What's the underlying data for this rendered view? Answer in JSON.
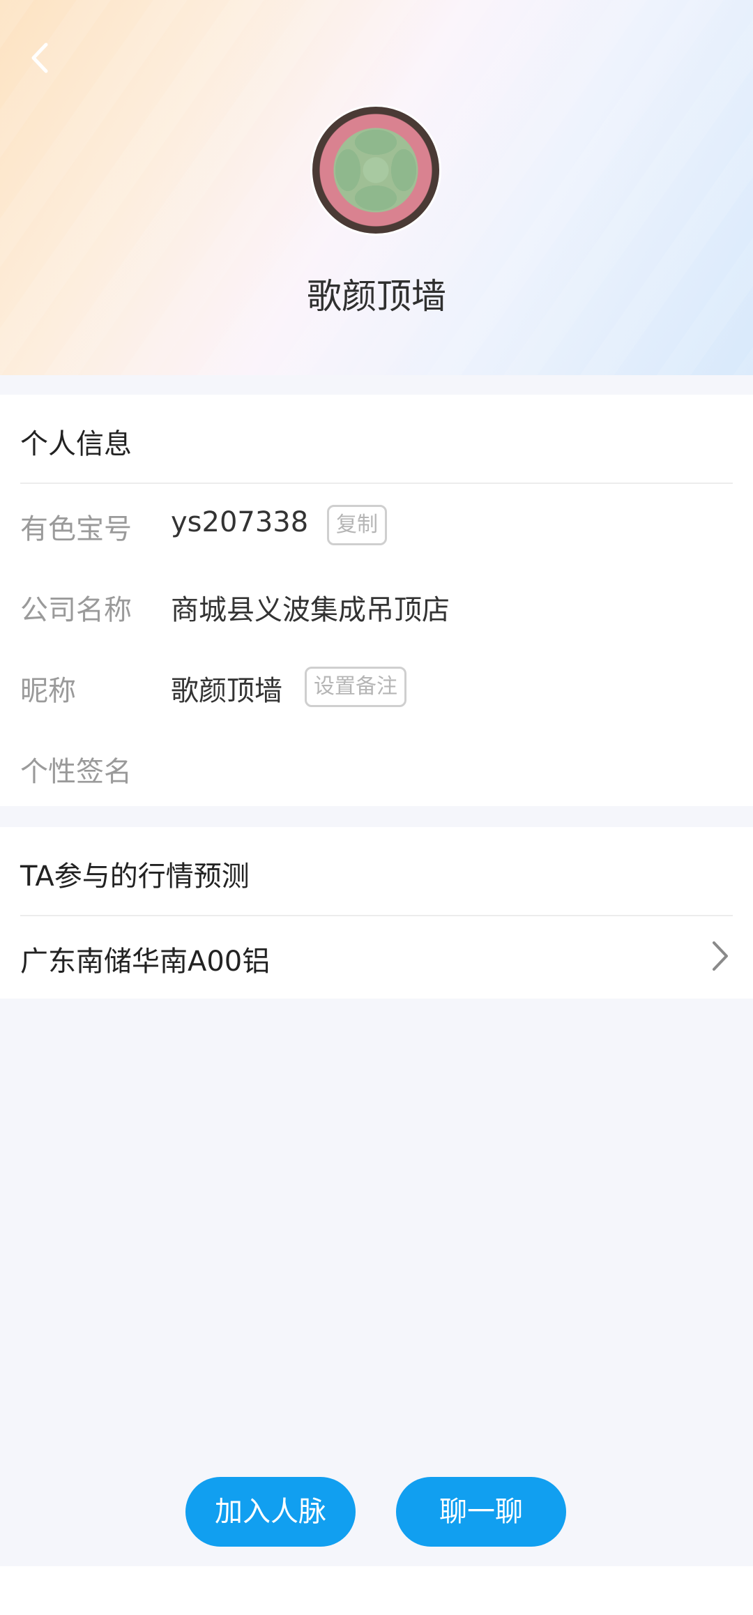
{
  "profile": {
    "name": "歌颜顶墙"
  },
  "personal_info": {
    "title": "个人信息",
    "rows": [
      {
        "label": "有色宝号",
        "value": "ys207338",
        "action": "复制"
      },
      {
        "label": "公司名称",
        "value": "商城县义波集成吊顶店"
      },
      {
        "label": "昵称",
        "value": "歌颜顶墙",
        "action": "设置备注"
      },
      {
        "label": "个性签名",
        "value": ""
      }
    ]
  },
  "predictions": {
    "title": "TA参与的行情预测",
    "items": [
      {
        "label": "广东南储华南A00铝"
      }
    ]
  },
  "buttons": {
    "add_contact": "加入人脉",
    "chat": "聊一聊"
  },
  "colors": {
    "primary": "#119ff0",
    "background": "#f5f6fb"
  }
}
